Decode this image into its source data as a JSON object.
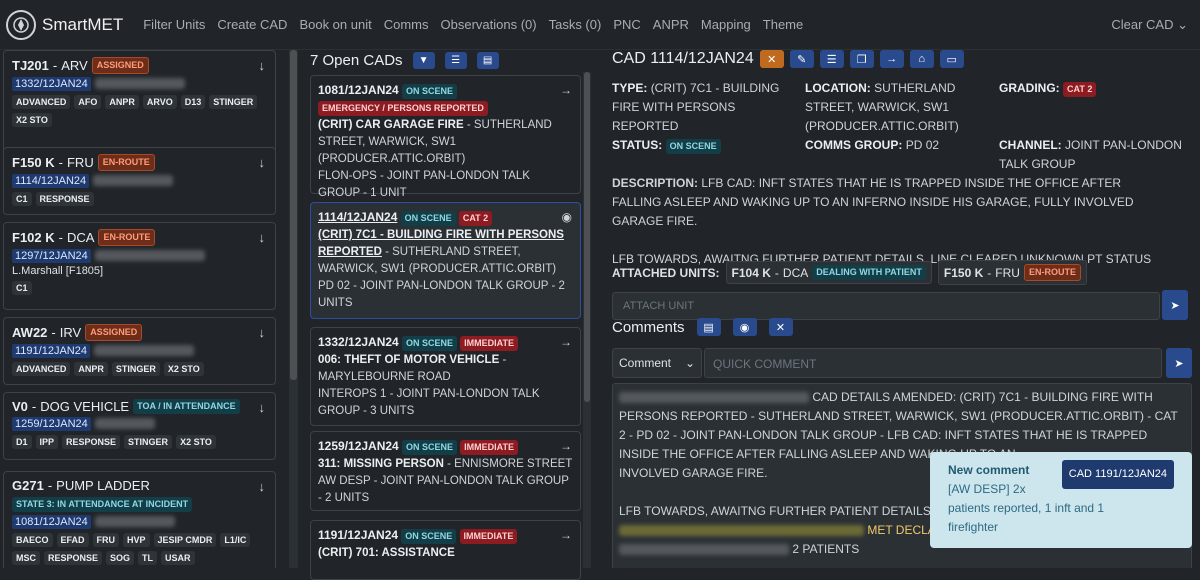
{
  "nav": {
    "brand": "SmartMET",
    "links": [
      "Filter Units",
      "Create CAD",
      "Book on unit",
      "Comms",
      "Observations (0)",
      "Tasks (0)",
      "PNC",
      "ANPR",
      "Mapping",
      "Theme"
    ],
    "clear": "Clear CAD",
    "clear_icon": "chevron-down-icon"
  },
  "units": [
    {
      "callsign": "TJ201",
      "type": "ARV",
      "status": "ASSIGNED",
      "cad": "1332/12JAN24",
      "tags": [
        "ADVANCED",
        "AFO",
        "ANPR",
        "ARVO",
        "D13",
        "STINGER",
        "X2 STO"
      ]
    },
    {
      "callsign": "F150 K",
      "type": "FRU",
      "status": "EN-ROUTE",
      "cad": "1114/12JAN24",
      "tags": [
        "C1",
        "RESPONSE"
      ]
    },
    {
      "callsign": "F102 K",
      "type": "DCA",
      "status": "EN-ROUTE",
      "cad": "1297/12JAN24",
      "person": "L.Marshall [F1805]",
      "tags": [
        "C1"
      ]
    },
    {
      "callsign": "AW22",
      "type": "IRV",
      "status": "ASSIGNED",
      "cad": "1191/12JAN24",
      "tags": [
        "ADVANCED",
        "ANPR",
        "STINGER",
        "X2 STO"
      ]
    },
    {
      "callsign": "V0",
      "type": "DOG VEHICLE",
      "status": "TOA / IN ATTENDANCE",
      "cad": "1259/12JAN24",
      "tags": [
        "D1",
        "IPP",
        "RESPONSE",
        "STINGER",
        "X2 STO"
      ]
    },
    {
      "callsign": "G271",
      "type": "PUMP LADDER",
      "status": "STATE 3: IN ATTENDANCE AT INCIDENT",
      "cad": "1081/12JAN24",
      "tags": [
        "BAECO",
        "EFAD",
        "FRU",
        "HVP",
        "JESIP CMDR",
        "L1/IC",
        "MSC",
        "RESPONSE",
        "SOG",
        "TL",
        "USAR"
      ]
    }
  ],
  "cads_title": "7 Open CADs",
  "cads": [
    {
      "id": "1081/12JAN24",
      "status": "ON SCENE",
      "flag": "EMERGENCY / PERSONS REPORTED",
      "title": "(CRIT) CAR GARAGE FIRE",
      "loc": " - SUTHERLAND STREET, WARWICK, SW1 (PRODUCER.ATTIC.ORBIT)",
      "group": "FLON-OPS - JOINT PAN-LONDON TALK GROUP - 1 UNIT"
    },
    {
      "id": "1114/12JAN24",
      "status": "ON SCENE",
      "flag": "CAT 2",
      "title": "(CRIT) 7C1 - BUILDING FIRE WITH PERSONS REPORTED",
      "loc": " - SUTHERLAND STREET, WARWICK, SW1 (PRODUCER.ATTIC.ORBIT)",
      "group": "PD 02 - JOINT PAN-LONDON TALK GROUP - 2 UNITS"
    },
    {
      "id": "1332/12JAN24",
      "status": "ON SCENE",
      "flag": "IMMEDIATE",
      "title": "006: THEFT OF MOTOR VEHICLE",
      "loc": " - MARYLEBOURNE ROAD",
      "group": "INTEROPS 1 - JOINT PAN-LONDON TALK GROUP - 3 UNITS"
    },
    {
      "id": "1259/12JAN24",
      "status": "ON SCENE",
      "flag": "IMMEDIATE",
      "title": "311: MISSING PERSON",
      "loc": " - ENNISMORE STREET",
      "group": "AW DESP - JOINT PAN-LONDON TALK GROUP - 2 UNITS"
    },
    {
      "id": "1191/12JAN24",
      "status": "ON SCENE",
      "flag": "IMMEDIATE",
      "title": "(CRIT) 701: ASSISTANCE",
      "loc": "",
      "group": ""
    }
  ],
  "detail": {
    "title": "CAD 1114/12JAN24",
    "type_label": "TYPE:",
    "type": "(CRIT) 7C1 - BUILDING FIRE WITH PERSONS REPORTED",
    "loc_label": "LOCATION:",
    "loc": "SUTHERLAND STREET, WARWICK, SW1 (PRODUCER.ATTIC.ORBIT)",
    "grading_label": "GRADING:",
    "grading": "CAT 2",
    "status_label": "STATUS:",
    "status": "ON SCENE",
    "comms_label": "COMMS GROUP:",
    "comms": "PD 02",
    "channel_label": "CHANNEL:",
    "channel": "JOINT PAN-LONDON TALK GROUP",
    "desc_label": "DESCRIPTION:",
    "desc": "LFB CAD: INFT STATES THAT HE IS TRAPPED INSIDE THE OFFICE AFTER FALLING ASLEEP AND WAKING UP TO AN INFERNO INSIDE HIS GARAGE, FULLY INVOLVED GARAGE FIRE.",
    "desc2": "LFB TOWARDS, AWAITNG FURTHER PATIENT DETAILS, LINE CLEARED UNKNOWN PT STATUS",
    "attached_label": "ATTACHED UNITS:",
    "attached": [
      {
        "unit": "F104 K",
        "type": "DCA",
        "status": "DEALING WITH PATIENT"
      },
      {
        "unit": "F150 K",
        "type": "FRU",
        "status": "EN-ROUTE"
      }
    ],
    "attach_placeholder": "ATTACH UNIT"
  },
  "comments": {
    "title": "Comments",
    "select": "Comment",
    "quick_placeholder": "QUICK COMMENT",
    "log1": "CAD DETAILS AMENDED: (CRIT) 7C1 - BUILDING FIRE WITH PERSONS REPORTED - SUTHERLAND STREET, WARWICK, SW1 (PRODUCER.ATTIC.ORBIT) - CAT 2 - PD 02 - JOINT PAN-LONDON TALK GROUP - LFB CAD: INFT STATES THAT HE IS TRAPPED INSIDE THE OFFICE AFTER FALLING ASLEEP AND WAKING UP TO AN",
    "log1b": "INVOLVED GARAGE FIRE.",
    "log2": "LFB TOWARDS, AWAITNG FURTHER PATIENT DETAILS, LINE",
    "log3": "MET DECLA",
    "log4": "2 PATIENTS"
  },
  "toast": {
    "title": "New comment",
    "button": "CAD 1191/12JAN24",
    "line1": "[AW DESP] 2x",
    "line2": "patients reported, 1 inft and 1",
    "line3": "firefighter"
  }
}
